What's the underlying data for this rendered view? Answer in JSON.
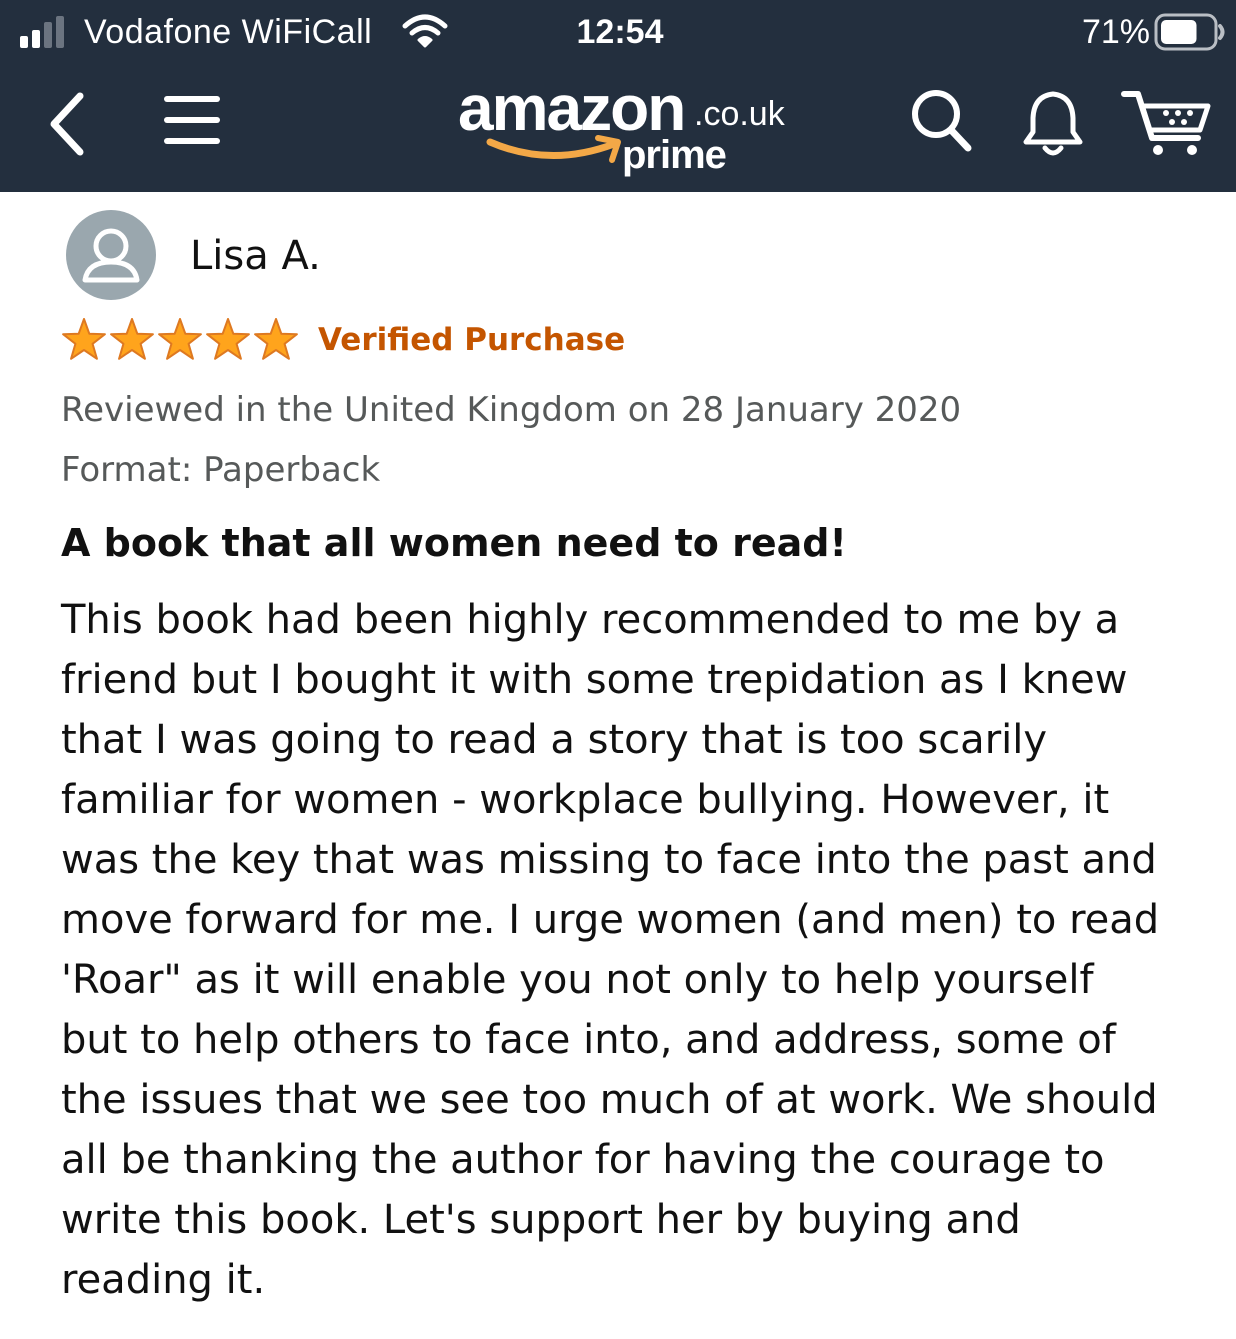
{
  "status_bar": {
    "carrier": "Vodafone WiFiCall",
    "time": "12:54",
    "battery_percent": "71%",
    "signal_bars_on": 2,
    "signal_bars_total": 4,
    "battery_level": 0.71
  },
  "nav": {
    "logo_word": "amazon",
    "logo_tld": ".co.uk",
    "logo_sub": "prime",
    "icons": [
      "back-arrow-icon",
      "hamburger-menu-icon",
      "search-icon",
      "bell-icon",
      "cart-icon"
    ],
    "colors": {
      "bar_background": "#232f3e",
      "logo_smile": "#f3a847"
    }
  },
  "review": {
    "reviewer_name": "Lisa A.",
    "rating": 5,
    "rating_max": 5,
    "verified_label": "Verified Purchase",
    "reviewed_line": "Reviewed in the United Kingdom on 28 January 2020",
    "format_line": "Format: Paperback",
    "title": "A book that all women need to read!",
    "body_lines": [
      "This book had been highly recommended to me by a",
      "friend but I bought it with some trepidation as I knew",
      "that I was going to read a story that is too scarily",
      "familiar for women - workplace bullying. However, it",
      "was the key that was missing to face into the past and",
      "move forward for me. I urge women (and men) to read",
      "'Roar\" as it will enable you not only to help yourself",
      "but to help others to face into, and address, some of",
      "the issues that we see too much of at work. We should",
      "all be thanking the author for having the courage to",
      "write this book. Let's support her by buying and",
      "reading it."
    ],
    "colors": {
      "star": "#ffa41c",
      "verified": "#c45500",
      "meta": "#565959"
    }
  }
}
